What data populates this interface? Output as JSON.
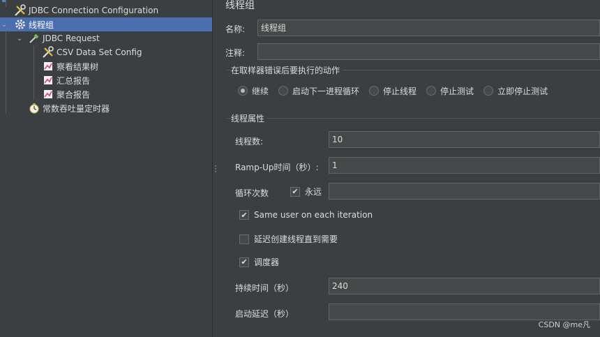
{
  "tree": {
    "items": [
      {
        "label": "JDBC Connection Configuration",
        "icon": "wrench-screwdriver-icon"
      },
      {
        "label": "线程组",
        "icon": "gear-icon"
      },
      {
        "label": "JDBC Request",
        "icon": "sampler-pipette-icon"
      },
      {
        "label": "CSV Data Set Config",
        "icon": "wrench-screwdriver-icon"
      },
      {
        "label": "察看结果树",
        "icon": "listener-graph-icon"
      },
      {
        "label": "汇总报告",
        "icon": "listener-graph-icon"
      },
      {
        "label": "聚合报告",
        "icon": "listener-graph-icon"
      },
      {
        "label": "常数吞吐量定时器",
        "icon": "timer-stopwatch-icon"
      }
    ]
  },
  "panel": {
    "title": "线程组",
    "name_label": "名称:",
    "name_value": "线程组",
    "comment_label": "注释:",
    "comment_value": "",
    "on_error": {
      "title": "在取样器错误后要执行的动作",
      "options": [
        "继续",
        "启动下一进程循环",
        "停止线程",
        "停止测试",
        "立即停止测试"
      ],
      "selected": "继续"
    },
    "props": {
      "title": "线程属性",
      "threads_label": "线程数:",
      "threads_value": "10",
      "rampup_label": "Ramp-Up时间（秒）:",
      "rampup_value": "1",
      "loop_label": "循环次数",
      "forever_label": "永远",
      "forever_checked": true,
      "loop_value": "",
      "same_user_label": "Same user on each iteration",
      "same_user_checked": true,
      "delay_label": "延迟创建线程直到需要",
      "delay_checked": false,
      "scheduler_label": "调度器",
      "scheduler_checked": true,
      "duration_label": "持续时间（秒）",
      "duration_value": "240",
      "startup_label": "启动延迟（秒）",
      "startup_value": ""
    }
  },
  "watermark": "CSDN @me凡",
  "colors": {
    "selection": "#4b6eaf",
    "background": "#3c3f41",
    "field": "#45494a"
  }
}
